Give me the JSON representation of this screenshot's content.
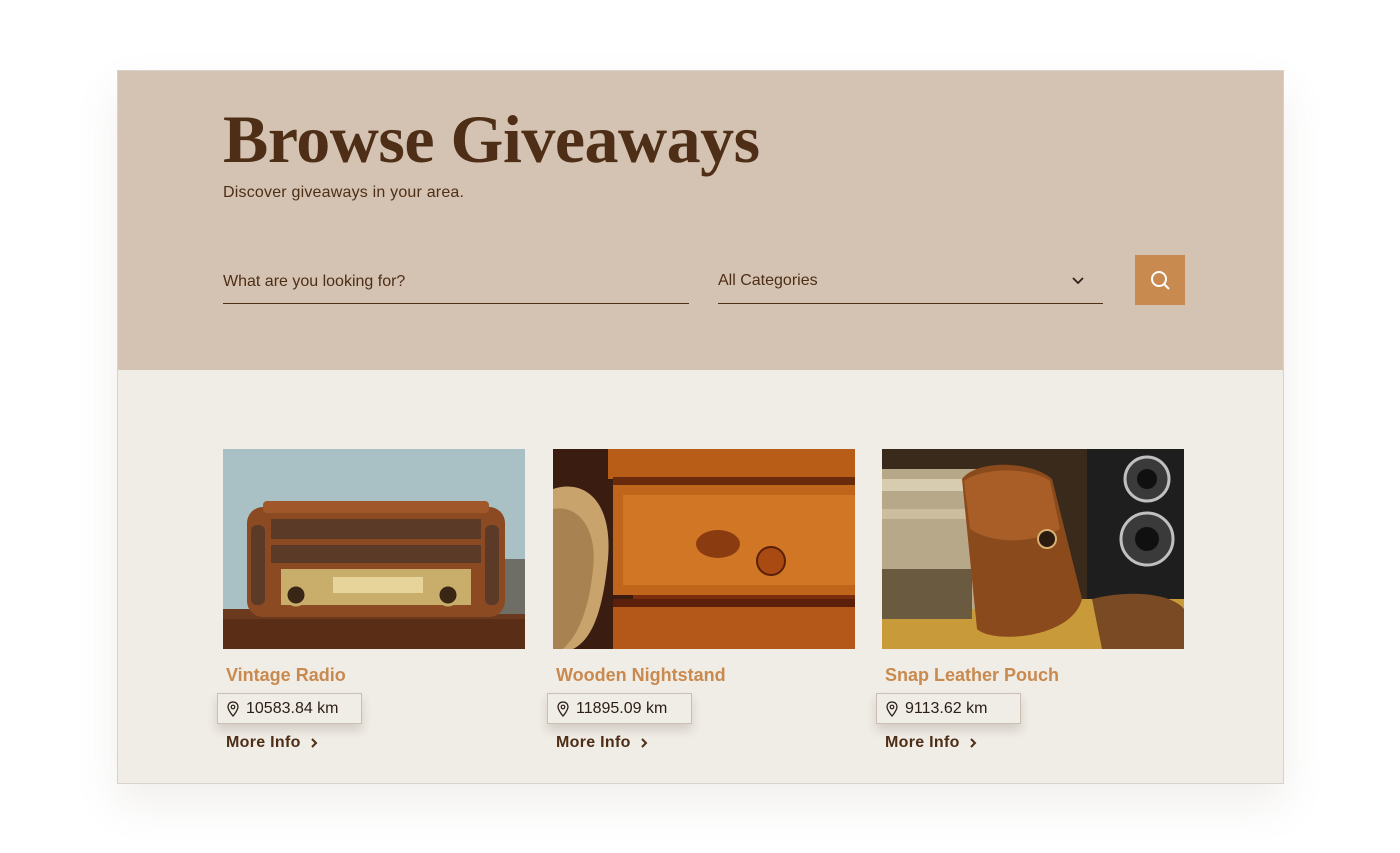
{
  "hero": {
    "title": "Browse Giveaways",
    "subtitle": "Discover giveaways in your area."
  },
  "search": {
    "placeholder": "What are you looking for?",
    "category_selected": "All Categories",
    "button_icon": "search-icon"
  },
  "cards": [
    {
      "title": "Vintage Radio",
      "distance": "10583.84 km",
      "link_label": "More Info",
      "image": "vintage-radio-photo"
    },
    {
      "title": "Wooden Nightstand",
      "distance": "11895.09 km",
      "link_label": "More Info",
      "image": "wooden-nightstand-photo"
    },
    {
      "title": "Snap Leather Pouch",
      "distance": "9113.62 km",
      "link_label": "More Info",
      "image": "leather-pouch-photo"
    }
  ],
  "colors": {
    "hero_bg": "#d4c3b2",
    "page_bg": "#f0ece6",
    "accent": "#c88a4f",
    "dark_brown": "#4e2e16"
  }
}
